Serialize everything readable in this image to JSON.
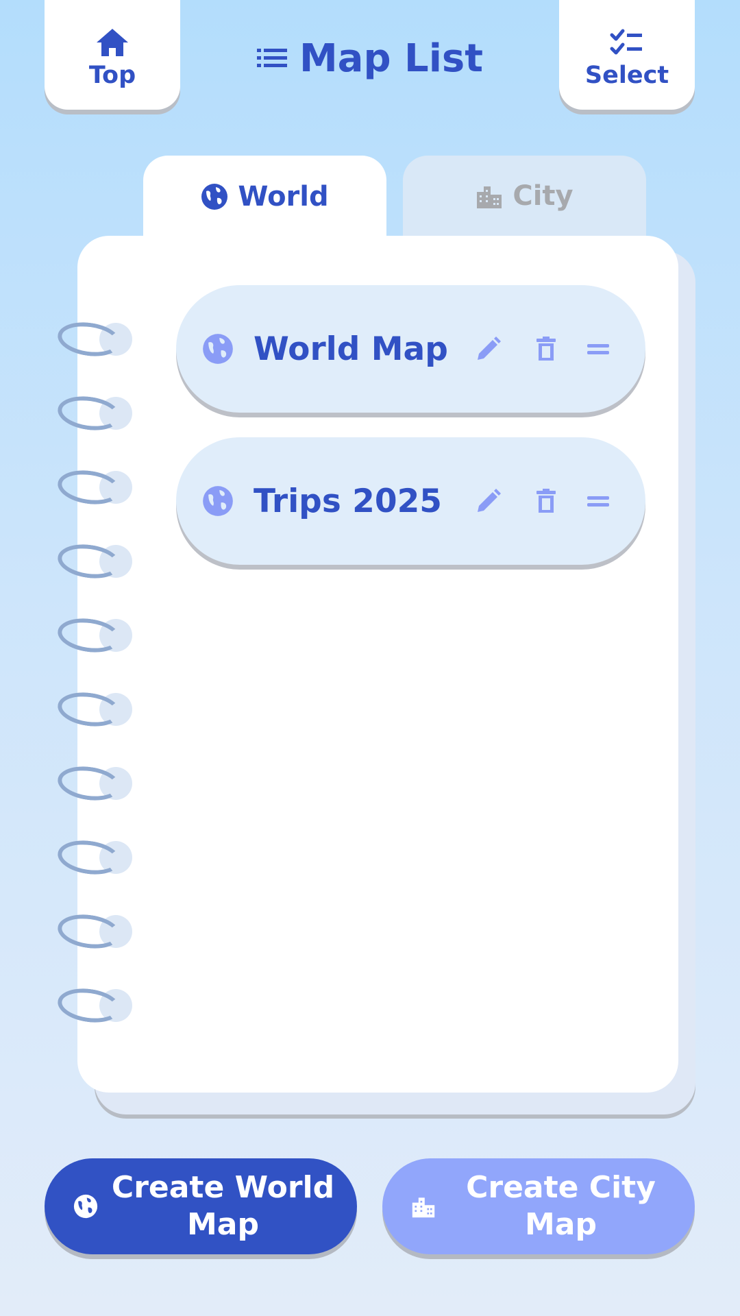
{
  "header": {
    "top_label": "Top",
    "title": "Map List",
    "select_label": "Select"
  },
  "tabs": [
    {
      "label": "World",
      "icon": "globe-icon",
      "active": true
    },
    {
      "label": "City",
      "icon": "city-icon",
      "active": false
    }
  ],
  "maps": [
    {
      "name": "World Map",
      "icon": "globe-icon"
    },
    {
      "name": "Trips 2025",
      "icon": "globe-icon"
    }
  ],
  "actions": {
    "create_world": "Create World Map",
    "create_city": "Create City Map"
  },
  "colors": {
    "primary": "#3151c4",
    "secondary": "#91a6fb",
    "item_bg": "#e0edfa",
    "icon_light": "#8a9cf6"
  }
}
